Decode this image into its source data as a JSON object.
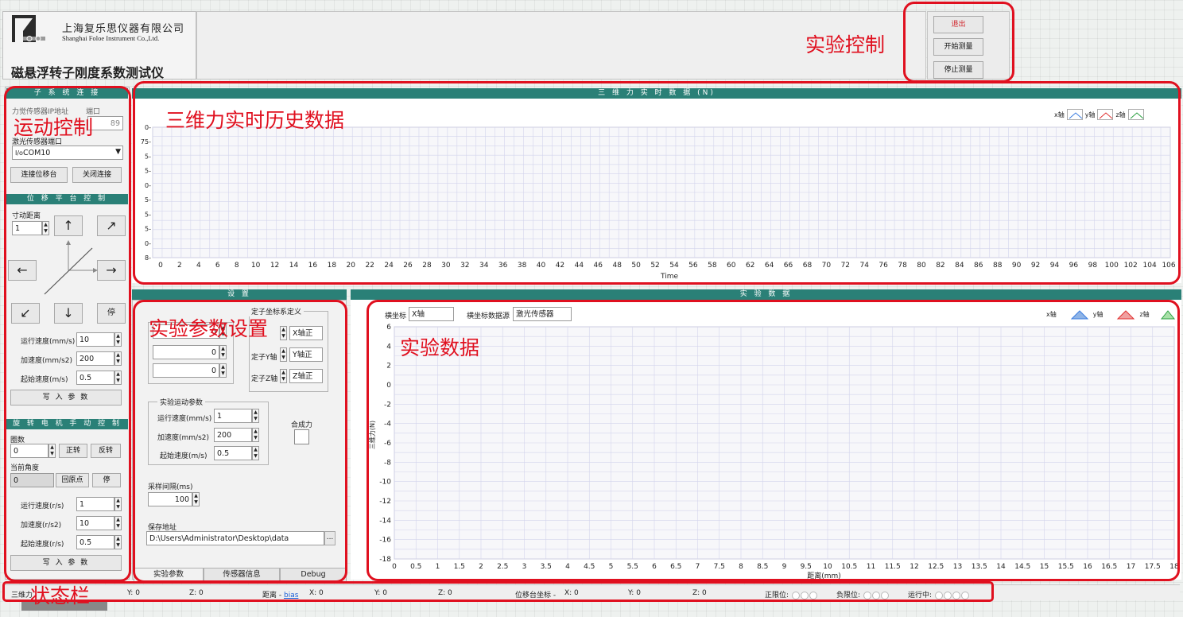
{
  "company": {
    "name_cn": "上海复乐思仪器有限公司",
    "name_en": "Shanghai Foloe Instrument Co.,Ltd."
  },
  "app_title": "磁悬浮转子刚度系数测试仪",
  "control_buttons": {
    "exit": "退出",
    "start": "开始测量",
    "stop": "停止测量"
  },
  "subsystem": {
    "title": "子 系 统 连 接",
    "force_ip_label": "力觉传感器IP地址",
    "port_label": "端口",
    "port_value": "89",
    "laser_port_label": "激光传感器端口",
    "laser_port_value": "COM10",
    "connect_btn": "连接位移台",
    "close_btn": "关闭连接"
  },
  "stage": {
    "title": "位 移 平 台 控 制",
    "jog_label": "寸动距离",
    "jog_value": "1",
    "up": "↑",
    "upright": "↗",
    "left": "←",
    "right": "→",
    "downleft": "↙",
    "down": "↓",
    "stop": "停",
    "speed_label": "运行速度(mm/s)",
    "speed_value": "10",
    "accel_label": "加速度(mm/s2)",
    "accel_value": "200",
    "start_speed_label": "起始速度(m/s)",
    "start_speed_value": "0.5",
    "write_btn": "写 入 参 数"
  },
  "motor": {
    "title": "旋 转 电 机 手 动 控 制",
    "turns_label": "圈数",
    "turns_value": "0",
    "forward_btn": "正转",
    "reverse_btn": "反转",
    "angle_label": "当前角度",
    "angle_value": "0",
    "origin_btn": "回原点",
    "stop_btn": "停",
    "speed_label": "运行速度(r/s)",
    "speed_value": "1",
    "accel_label": "加速度(r/s2)",
    "accel_value": "10",
    "start_speed_label": "起始速度(r/s)",
    "start_speed_value": "0.5",
    "write_btn": "写 入 参 数"
  },
  "force_chart": {
    "title": "三 维 力 实 时 数 据 (N)",
    "xlabel": "Time",
    "legend": [
      "x轴",
      "y轴",
      "z轴"
    ],
    "legend_colors": [
      "#3d7ee0",
      "#e03030",
      "#2aa040"
    ],
    "y_ticks_partial": [
      "0-",
      "75-",
      "5-",
      "5-",
      "0-",
      "5-",
      "5-",
      "5-",
      "0-",
      "8-"
    ],
    "x_ticks": [
      "0",
      "2",
      "4",
      "6",
      "8",
      "10",
      "12",
      "14",
      "16",
      "18",
      "20",
      "22",
      "24",
      "26",
      "28",
      "30",
      "32",
      "34",
      "36",
      "38",
      "40",
      "42",
      "44",
      "46",
      "48",
      "50",
      "52",
      "54",
      "56",
      "58",
      "60",
      "62",
      "64",
      "66",
      "68",
      "70",
      "72",
      "74",
      "76",
      "78",
      "80",
      "82",
      "84",
      "86",
      "88",
      "90",
      "92",
      "94",
      "96",
      "98",
      "100",
      "102",
      "104",
      "106"
    ]
  },
  "settings": {
    "title": "设 置",
    "coord_group": "定子坐标系定义",
    "val1": "0",
    "val2": "0",
    "val3": "0",
    "stator_y_label": "定子Y轴",
    "stator_z_label": "定子Z轴",
    "x_dir": "X轴正",
    "y_dir": "Y轴正",
    "z_dir": "Z轴正",
    "motion_group": "实验运动参数",
    "speed_label": "运行速度(mm/s)",
    "speed_value": "1",
    "accel_label": "加速度(mm/s2)",
    "accel_value": "200",
    "start_speed_label": "起始速度(m/s)",
    "start_speed_value": "0.5",
    "resultant_label": "合成力",
    "sample_label": "采样间隔(ms)",
    "sample_value": "100",
    "save_label": "保存地址",
    "save_path": "D:\\Users\\Administrator\\Desktop\\data",
    "browse": "...",
    "tabs": [
      "实验参数",
      "传感器信息",
      "Debug"
    ]
  },
  "exp_chart": {
    "title": "实 验 数 据",
    "xaxis_label": "横坐标",
    "xaxis_value": "X轴",
    "xsource_label": "横坐标数据源",
    "xsource_value": "激光传感器",
    "legend": [
      "x轴",
      "y轴",
      "z轴"
    ],
    "legend_colors": [
      "#3d7ee0",
      "#e03030",
      "#2aa040"
    ],
    "ylabel": "三维力(N)",
    "xlabel": "距离(mm)",
    "y_ticks": [
      "6",
      "4",
      "2",
      "0",
      "-2",
      "-4",
      "-6",
      "-8",
      "-10",
      "-12",
      "-14",
      "-16",
      "-18"
    ],
    "x_ticks": [
      "0",
      "0.5",
      "1",
      "1.5",
      "2",
      "2.5",
      "3",
      "3.5",
      "4",
      "4.5",
      "5",
      "5.5",
      "6",
      "6.5",
      "7",
      "7.5",
      "8",
      "8.5",
      "9",
      "9.5",
      "10",
      "10.5",
      "11",
      "11.5",
      "12",
      "12.5",
      "13",
      "13.5",
      "14",
      "14.5",
      "15",
      "15.5",
      "16",
      "16.5",
      "17",
      "17.5",
      "18"
    ]
  },
  "status": {
    "force_prefix": "三维力",
    "y": "Y: 0",
    "z": "Z: 0",
    "dist_label": "距离 - ",
    "bias": "bias",
    "dist_x": "X: 0",
    "dist_y": "Y: 0",
    "dist_z": "Z: 0",
    "stage_label": "位移台坐标 - ",
    "stage_x": "X: 0",
    "stage_y": "Y: 0",
    "stage_z": "Z: 0",
    "pos_limit": "正限位:",
    "neg_limit": "负限位:",
    "running": "运行中:"
  },
  "annotations": {
    "exp_control": "实验控制",
    "motion_control": "运动控制",
    "force_history": "三维力实时历史数据",
    "exp_params": "实验参数设置",
    "exp_data": "实验数据",
    "status_bar": "状态栏"
  }
}
